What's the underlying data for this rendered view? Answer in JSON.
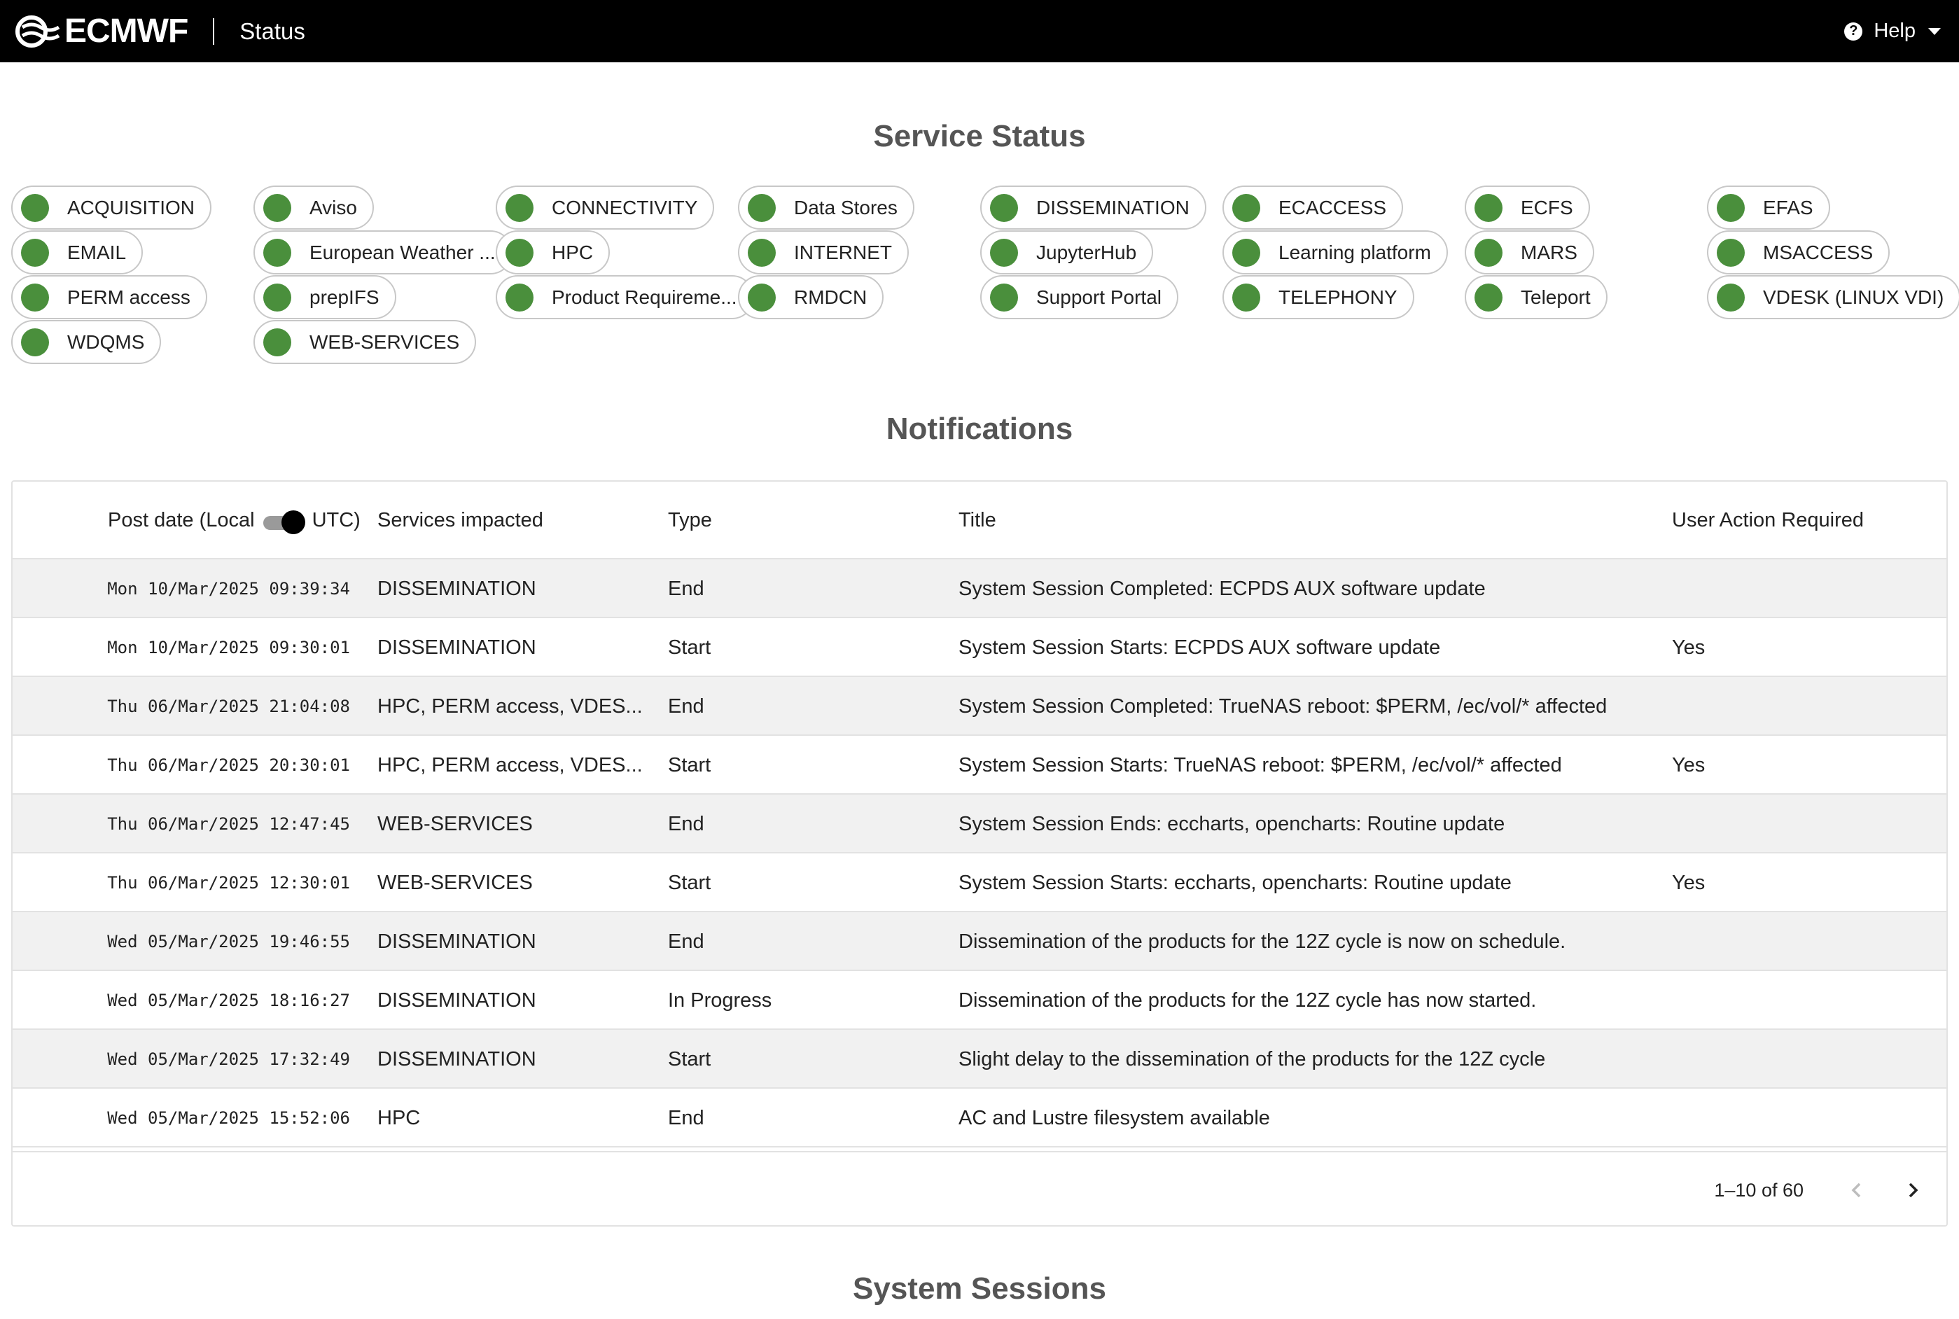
{
  "header": {
    "brand": "ECMWF",
    "page_name": "Status",
    "help_label": "Help"
  },
  "service_status": {
    "title": "Service Status",
    "status_color": "#4a8f3c",
    "columns": [
      [
        "ACQUISITION",
        "EMAIL",
        "PERM access",
        "WDQMS"
      ],
      [
        "Aviso",
        "European Weather ...",
        "prepIFS",
        "WEB-SERVICES"
      ],
      [
        "CONNECTIVITY",
        "HPC",
        "Product Requireme..."
      ],
      [
        "Data Stores",
        "INTERNET",
        "RMDCN"
      ],
      [
        "DISSEMINATION",
        "JupyterHub",
        "Support Portal"
      ],
      [
        "ECACCESS",
        "Learning platform",
        "TELEPHONY"
      ],
      [
        "ECFS",
        "MARS",
        "Teleport"
      ],
      [
        "EFAS",
        "MSACCESS",
        "VDESK (LINUX VDI)"
      ]
    ]
  },
  "notifications": {
    "title": "Notifications",
    "headers": {
      "post_date_left": "Post date (Local",
      "post_date_right": "UTC)",
      "services": "Services impacted",
      "type": "Type",
      "title": "Title",
      "user_action": "User Action Required"
    },
    "rows": [
      {
        "date": "Mon 10/Mar/2025 09:39:34",
        "services": "DISSEMINATION",
        "type": "End",
        "title": "System Session Completed: ECPDS AUX software update",
        "action": ""
      },
      {
        "date": "Mon 10/Mar/2025 09:30:01",
        "services": "DISSEMINATION",
        "type": "Start",
        "title": "System Session Starts: ECPDS AUX software update",
        "action": "Yes"
      },
      {
        "date": "Thu 06/Mar/2025 21:04:08",
        "services": "HPC, PERM access, VDES...",
        "type": "End",
        "title": "System Session Completed: TrueNAS reboot: $PERM, /ec/vol/* affected",
        "action": ""
      },
      {
        "date": "Thu 06/Mar/2025 20:30:01",
        "services": "HPC, PERM access, VDES...",
        "type": "Start",
        "title": "System Session Starts: TrueNAS reboot: $PERM, /ec/vol/* affected",
        "action": "Yes"
      },
      {
        "date": "Thu 06/Mar/2025 12:47:45",
        "services": "WEB-SERVICES",
        "type": "End",
        "title": "System Session Ends: eccharts, opencharts: Routine update",
        "action": ""
      },
      {
        "date": "Thu 06/Mar/2025 12:30:01",
        "services": "WEB-SERVICES",
        "type": "Start",
        "title": "System Session Starts: eccharts, opencharts: Routine update",
        "action": "Yes"
      },
      {
        "date": "Wed 05/Mar/2025 19:46:55",
        "services": "DISSEMINATION",
        "type": "End",
        "title": "Dissemination of the products for the 12Z cycle is now on schedule.",
        "action": ""
      },
      {
        "date": "Wed 05/Mar/2025 18:16:27",
        "services": "DISSEMINATION",
        "type": "In Progress",
        "title": "Dissemination of the products for the 12Z cycle has now started.",
        "action": ""
      },
      {
        "date": "Wed 05/Mar/2025 17:32:49",
        "services": "DISSEMINATION",
        "type": "Start",
        "title": "Slight delay to the dissemination of the products for the 12Z cycle",
        "action": ""
      },
      {
        "date": "Wed 05/Mar/2025 15:52:06",
        "services": "HPC",
        "type": "End",
        "title": "AC and Lustre filesystem available",
        "action": ""
      }
    ],
    "pagination": "1–10 of 60"
  },
  "system_sessions": {
    "title": "System Sessions"
  }
}
